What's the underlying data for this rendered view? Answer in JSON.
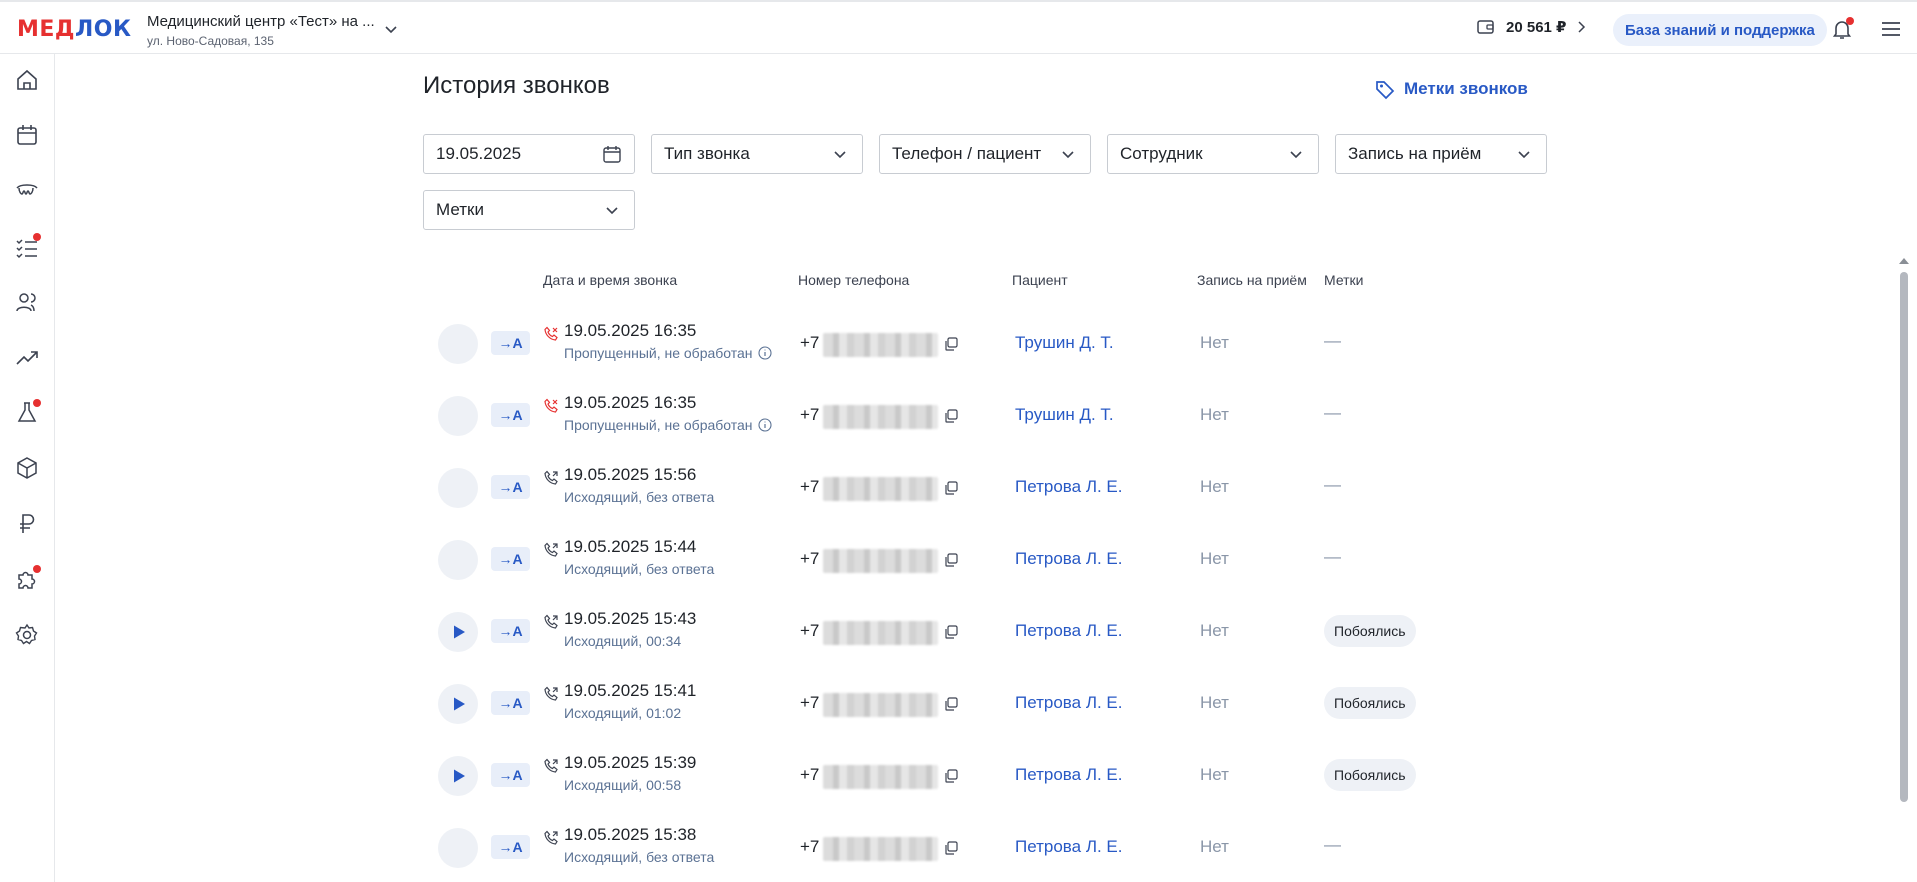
{
  "header": {
    "logo_left": "МЕД",
    "logo_right": "ЛОК",
    "clinic_name": "Медицинский центр «Тест» на ...",
    "clinic_address": "ул. Ново-Садовая, 135",
    "balance": "20 561 ₽",
    "support_label": "База знаний и поддержка"
  },
  "sidebar": {
    "items": [
      {
        "icon": "home-icon"
      },
      {
        "icon": "calendar-icon"
      },
      {
        "icon": "teeth-icon"
      },
      {
        "icon": "tasks-icon",
        "badge": true
      },
      {
        "icon": "users-icon"
      },
      {
        "icon": "analytics-icon"
      },
      {
        "icon": "lab-flask-icon",
        "badge": true
      },
      {
        "icon": "box-icon"
      },
      {
        "icon": "ruble-icon"
      },
      {
        "icon": "puzzle-icon",
        "badge": true
      },
      {
        "icon": "settings-icon"
      }
    ]
  },
  "main": {
    "title": "История звонков",
    "tags_link": "Метки звонков",
    "filters": {
      "date": "19.05.2025",
      "call_type": "Тип звонка",
      "phone_patient": "Телефон / пациент",
      "employee": "Сотрудник",
      "appointment": "Запись на приём",
      "tags": "Метки"
    },
    "columns": {
      "datetime": "Дата и время звонка",
      "phone": "Номер телефона",
      "patient": "Пациент",
      "appointment": "Запись на приём",
      "tags": "Метки"
    },
    "ai_label": "→A",
    "rows": [
      {
        "datetime": "19.05.2025 16:35",
        "status": "Пропущенный, не обработан",
        "missed": true,
        "has_record": false,
        "phone_prefix": "+7",
        "patient": "Трушин Д. Т.",
        "appointment": "Нет",
        "tag": "—"
      },
      {
        "datetime": "19.05.2025 16:35",
        "status": "Пропущенный, не обработан",
        "missed": true,
        "has_record": false,
        "phone_prefix": "+7",
        "patient": "Трушин Д. Т.",
        "appointment": "Нет",
        "tag": "—"
      },
      {
        "datetime": "19.05.2025 15:56",
        "status": "Исходящий, без ответа",
        "missed": false,
        "has_record": false,
        "phone_prefix": "+7",
        "patient": "Петрова Л. Е.",
        "appointment": "Нет",
        "tag": "—"
      },
      {
        "datetime": "19.05.2025 15:44",
        "status": "Исходящий, без ответа",
        "missed": false,
        "has_record": false,
        "phone_prefix": "+7",
        "patient": "Петрова Л. Е.",
        "appointment": "Нет",
        "tag": "—"
      },
      {
        "datetime": "19.05.2025 15:43",
        "status": "Исходящий, 00:34",
        "missed": false,
        "has_record": true,
        "phone_prefix": "+7",
        "patient": "Петрова Л. Е.",
        "appointment": "Нет",
        "tag": "Побоялись"
      },
      {
        "datetime": "19.05.2025 15:41",
        "status": "Исходящий, 01:02",
        "missed": false,
        "has_record": true,
        "phone_prefix": "+7",
        "patient": "Петрова Л. Е.",
        "appointment": "Нет",
        "tag": "Побоялись"
      },
      {
        "datetime": "19.05.2025 15:39",
        "status": "Исходящий, 00:58",
        "missed": false,
        "has_record": true,
        "phone_prefix": "+7",
        "patient": "Петрова Л. Е.",
        "appointment": "Нет",
        "tag": "Побоялись"
      },
      {
        "datetime": "19.05.2025 15:38",
        "status": "Исходящий, без ответа",
        "missed": false,
        "has_record": false,
        "phone_prefix": "+7",
        "patient": "Петрова Л. Е.",
        "appointment": "Нет",
        "tag": "—"
      }
    ]
  }
}
